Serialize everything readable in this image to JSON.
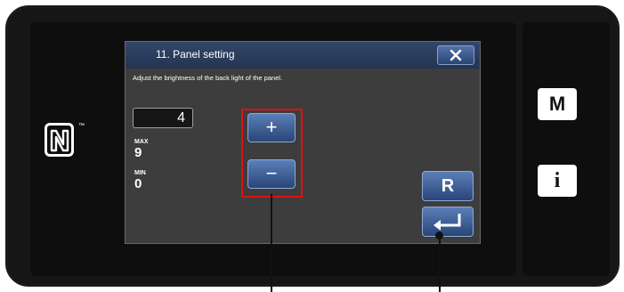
{
  "dialog": {
    "title": "11.  Panel setting",
    "close_icon": "close-icon",
    "description": "Adjust the brightness of the back light of the panel."
  },
  "value": {
    "current": "4",
    "max_label": "MAX",
    "max_value": "9",
    "min_label": "MIN",
    "min_value": "0"
  },
  "buttons": {
    "plus_label": "+",
    "minus_label": "−",
    "reset_label": "R",
    "enter_icon": "enter-icon"
  },
  "side": {
    "m_label": "M",
    "info_label": "i"
  },
  "nfc": {
    "tm": "™"
  },
  "colors": {
    "title_bar": "#2b3f63",
    "button_blue": "#3f5f96",
    "highlight": "#e01010",
    "panel_bg": "#3d3d3d"
  }
}
